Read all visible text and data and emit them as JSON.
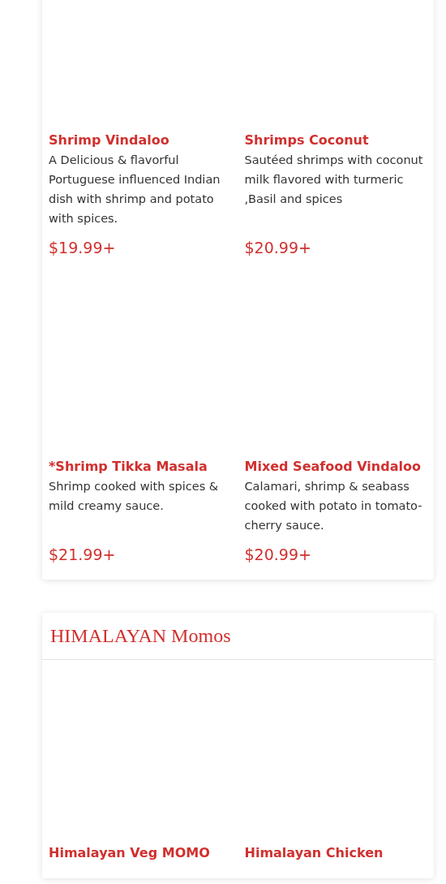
{
  "sections": [
    {
      "items": [
        {
          "name": "Shrimp Vindaloo",
          "description": "A Delicious & flavorful Portuguese influenced Indian dish with shrimp and potato with spices.",
          "price": "$19.99+"
        },
        {
          "name": "Shrimps Coconut",
          "description": "Sautéed shrimps with coconut milk flavored with turmeric ,Basil and spices",
          "price": "$20.99+"
        },
        {
          "name": "*Shrimp Tikka Masala",
          "description": "Shrimp cooked with spices & mild creamy sauce.",
          "price": "$21.99+"
        },
        {
          "name": "Mixed Seafood Vindaloo",
          "description": "Calamari, shrimp & seabass cooked with potato in tomato-cherry sauce.",
          "price": "$20.99+"
        }
      ]
    },
    {
      "title": "HIMALAYAN Momos",
      "items": [
        {
          "name": "Himalayan Veg MOMO"
        },
        {
          "name": "Himalayan Chicken"
        }
      ]
    }
  ]
}
